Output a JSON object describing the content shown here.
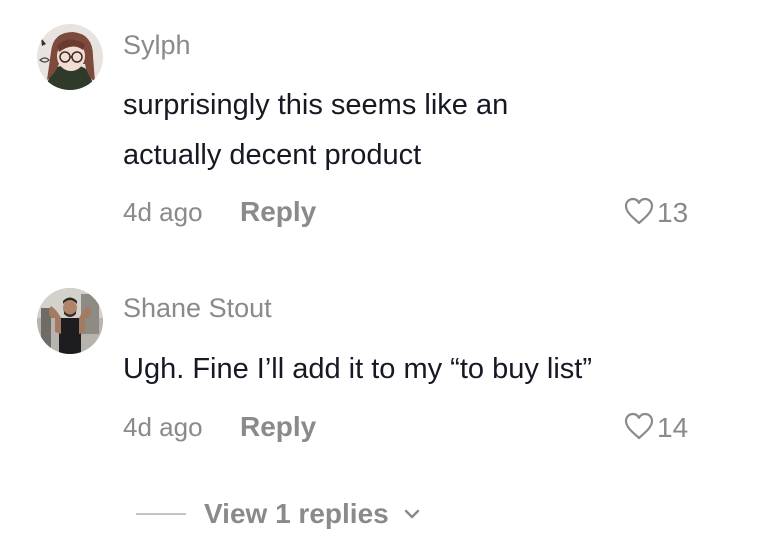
{
  "comments": [
    {
      "username": "Sylph",
      "text_lines": [
        "surprisingly this seems like an",
        "actually decent product"
      ],
      "time": "4d ago",
      "reply_label": "Reply",
      "like_count": "13",
      "avatar": "anime-avatar"
    },
    {
      "username": "Shane Stout",
      "text_lines": [
        "Ugh. Fine I’ll add it to my “to buy list”"
      ],
      "time": "4d ago",
      "reply_label": "Reply",
      "like_count": "14",
      "avatar": "photo-avatar"
    }
  ],
  "view_replies": {
    "label": "View 1 replies",
    "icon": "chevron-down-icon"
  },
  "icons": {
    "like": "heart-outline-icon"
  },
  "colors": {
    "text_primary": "#161823",
    "text_secondary": "#8a8a8a",
    "divider": "#c4c4c4"
  }
}
